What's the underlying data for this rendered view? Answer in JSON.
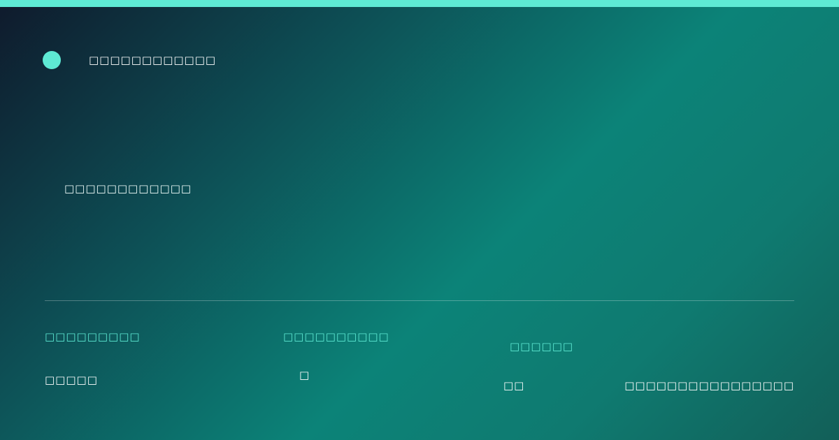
{
  "header": {
    "brand": "□□□□□□□□□□□□"
  },
  "headline": "□□□□□□□□□□□□",
  "stats": [
    {
      "label": "□□□□□□□□□",
      "value": "□□□□□"
    },
    {
      "label": "□□□□□□□□□□",
      "value": "□"
    },
    {
      "label": "□□□□□□",
      "value": "□□"
    }
  ],
  "footer": {
    "note": "□□□□□□□□□□□□□□□□"
  },
  "colors": {
    "accent": "#5eead4",
    "background_start": "#0f1a2c",
    "background_mid": "#0c8378",
    "background_end": "#125f58"
  },
  "icons": {
    "logo": "logo-dot-icon"
  }
}
